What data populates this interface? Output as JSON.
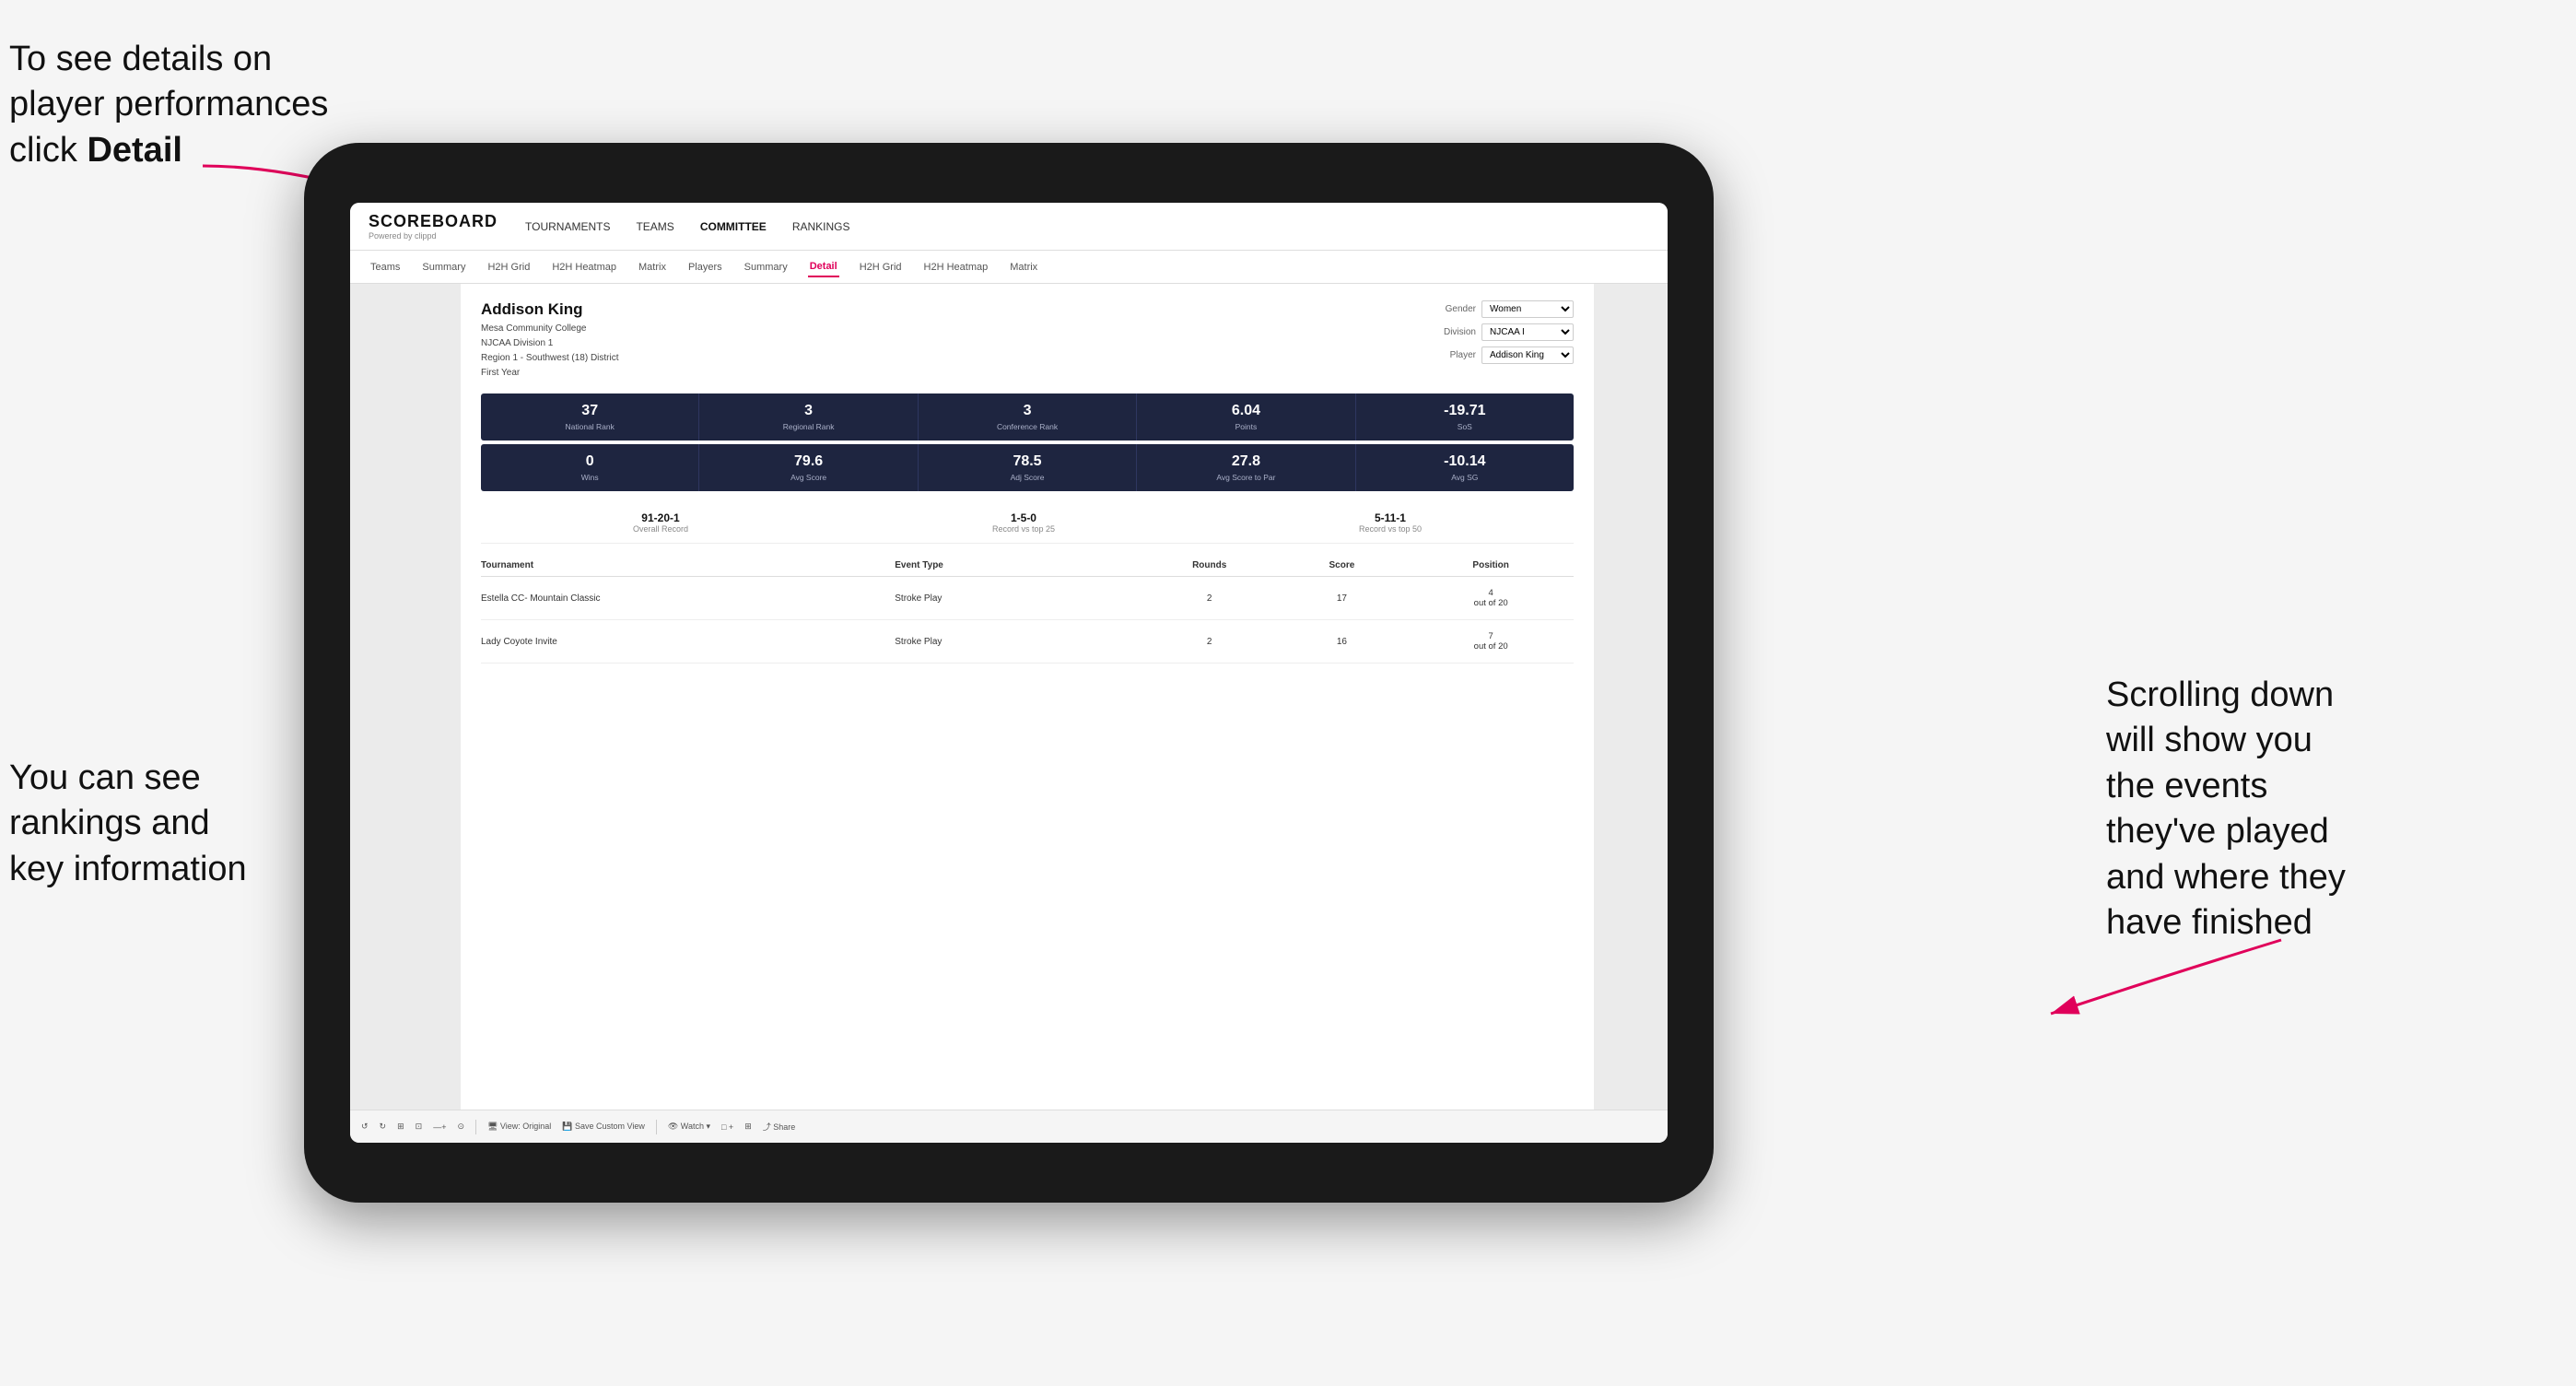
{
  "annotations": {
    "top_left": "To see details on\nplayer performances\nclick ",
    "top_left_bold": "Detail",
    "bottom_left": "You can see\nrankings and\nkey information",
    "bottom_right": "Scrolling down\nwill show you\nthe events\nthey've played\nand where they\nhave finished"
  },
  "nav": {
    "logo": "SCOREBOARD",
    "logo_sub": "Powered by clippd",
    "items": [
      "TOURNAMENTS",
      "TEAMS",
      "COMMITTEE",
      "RANKINGS"
    ]
  },
  "sub_nav": {
    "items": [
      "Teams",
      "Summary",
      "H2H Grid",
      "H2H Heatmap",
      "Matrix",
      "Players",
      "Summary",
      "Detail",
      "H2H Grid",
      "H2H Heatmap",
      "Matrix"
    ],
    "active": "Detail"
  },
  "player": {
    "name": "Addison King",
    "school": "Mesa Community College",
    "division": "NJCAA Division 1",
    "region": "Region 1 - Southwest (18) District",
    "year": "First Year"
  },
  "filters": {
    "gender_label": "Gender",
    "gender_value": "Women",
    "division_label": "Division",
    "division_value": "NJCAA I",
    "player_label": "Player",
    "player_value": "Addison King"
  },
  "stats_row1": [
    {
      "value": "37",
      "label": "National Rank"
    },
    {
      "value": "3",
      "label": "Regional Rank"
    },
    {
      "value": "3",
      "label": "Conference Rank"
    },
    {
      "value": "6.04",
      "label": "Points"
    },
    {
      "value": "-19.71",
      "label": "SoS"
    }
  ],
  "stats_row2": [
    {
      "value": "0",
      "label": "Wins"
    },
    {
      "value": "79.6",
      "label": "Avg Score"
    },
    {
      "value": "78.5",
      "label": "Adj Score"
    },
    {
      "value": "27.8",
      "label": "Avg Score to Par"
    },
    {
      "value": "-10.14",
      "label": "Avg SG"
    }
  ],
  "records": [
    {
      "value": "91-20-1",
      "label": "Overall Record"
    },
    {
      "value": "1-5-0",
      "label": "Record vs top 25"
    },
    {
      "value": "5-11-1",
      "label": "Record vs top 50"
    }
  ],
  "table": {
    "headers": [
      "Tournament",
      "Event Type",
      "Rounds",
      "Score",
      "Position"
    ],
    "rows": [
      {
        "tournament": "Estella CC- Mountain Classic",
        "event_type": "Stroke Play",
        "rounds": "2",
        "score": "17",
        "position": "4\nout of 20"
      },
      {
        "tournament": "Lady Coyote Invite",
        "event_type": "Stroke Play",
        "rounds": "2",
        "score": "16",
        "position": "7\nout of 20"
      }
    ]
  },
  "toolbar": {
    "items": [
      "↺",
      "↻",
      "⊞",
      "⊡",
      "—+",
      "⊙",
      "View: Original",
      "Save Custom View",
      "Watch ▾",
      "□ +",
      "⊞",
      "Share"
    ]
  }
}
